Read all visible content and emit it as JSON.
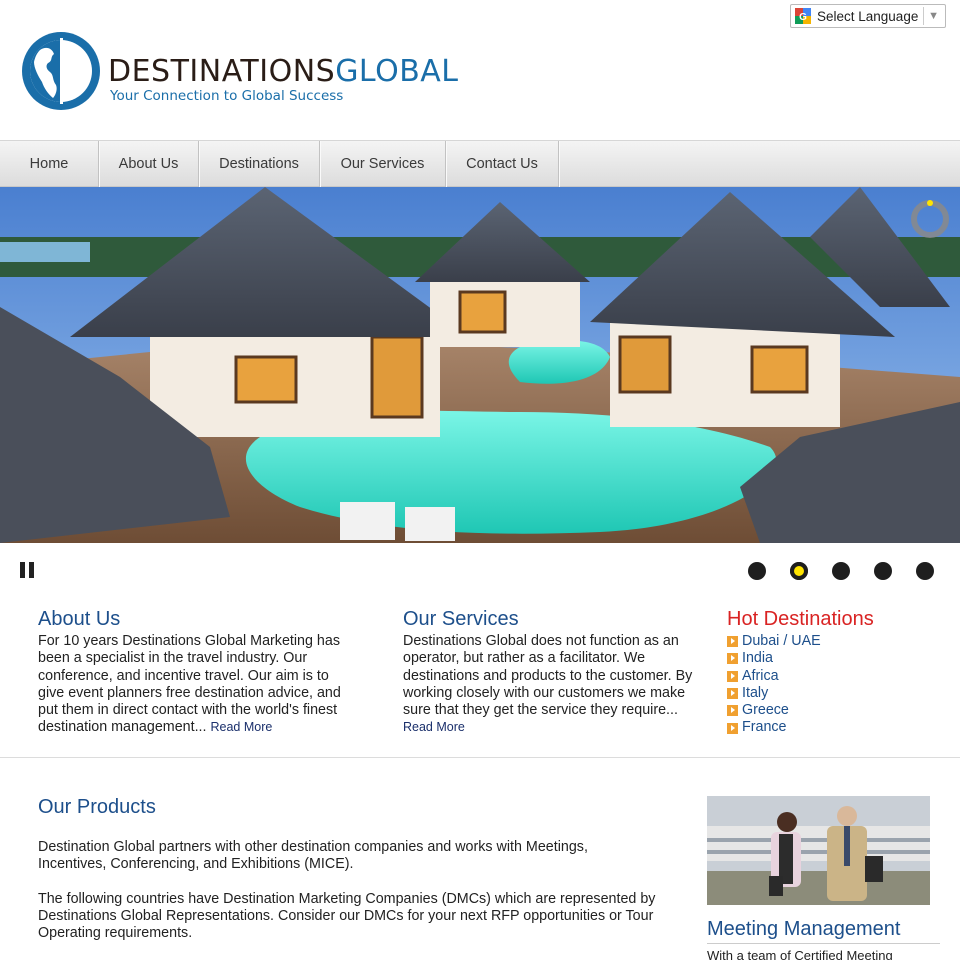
{
  "brand": {
    "name_part1": "DESTINATIONS",
    "name_part2": "GLOBAL",
    "tagline": "Your Connection to Global Success",
    "colors": {
      "dark": "#2a1d17",
      "blue": "#1a6ea9"
    }
  },
  "language": {
    "label": "Select Language",
    "icon": "google-translate-icon"
  },
  "nav": {
    "items": [
      {
        "label": "Home"
      },
      {
        "label": "About Us"
      },
      {
        "label": "Destinations"
      },
      {
        "label": "Our Services"
      },
      {
        "label": "Contact Us"
      }
    ]
  },
  "slider": {
    "slide_count": 5,
    "active_index": 1,
    "pause_icon": "pause-icon",
    "loader_icon": "loading-ring-icon"
  },
  "about": {
    "heading": "About Us",
    "text": "For 10 years Destinations Global Marketing has been a specialist in the travel industry. Our conference, and incentive travel. Our aim is to give event planners free destination advice, and put them in direct contact with the world's finest destination management...",
    "read_more": "Read More"
  },
  "services": {
    "heading": "Our Services",
    "text": "Destinations Global does not function as an operator, but rather as a facilitator. We destinations and products to the customer. By working closely with our customers we make sure that they get the service they require...",
    "read_more": "Read More"
  },
  "hot": {
    "heading": "Hot Destinations",
    "items": [
      "Dubai / UAE",
      "India",
      "Africa",
      "Italy",
      "Greece",
      "France"
    ],
    "heading_color": "#d92323"
  },
  "products": {
    "heading": "Our Products",
    "para1": "Destination Global partners with other destination companies and works with Meetings, Incentives, Conferencing, and Exhibitions (MICE).",
    "para2": "The following countries have Destination Marketing Companies (DMCs) which are represented by Destinations Global Representations. Consider our DMCs for your next RFP opportunities or Tour Operating requirements."
  },
  "meeting": {
    "heading": "Meeting Management",
    "text": "With a team of Certified Meeting"
  }
}
